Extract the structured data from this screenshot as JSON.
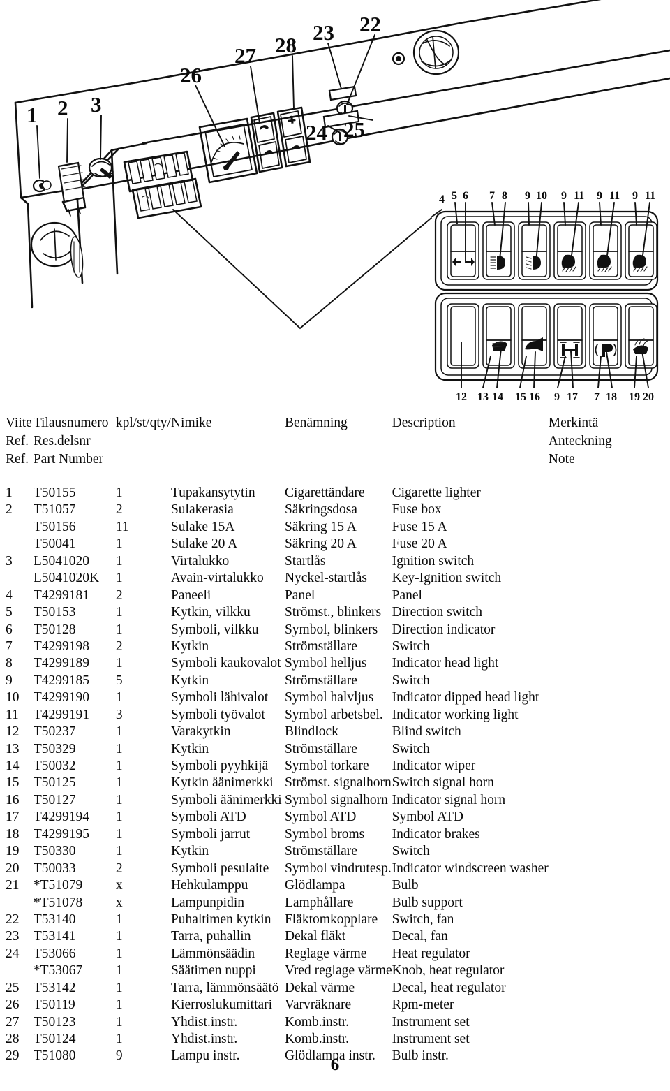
{
  "page": {
    "number": "6"
  },
  "diagram": {
    "title": "dashboard-panel-exploded-view",
    "panel_callouts_top": [
      "1",
      "2",
      "3",
      "26",
      "27",
      "28",
      "23",
      "22"
    ],
    "panel_callouts_bottom": [
      "24",
      "25"
    ],
    "switch_callouts_top": [
      "4",
      "5",
      "6",
      "7",
      "8",
      "9",
      "10",
      "9",
      "11",
      "9",
      "11",
      "9",
      "11"
    ],
    "switch_callouts_bottom": [
      "12",
      "13",
      "14",
      "15",
      "16",
      "9",
      "17",
      "7",
      "18",
      "19",
      "20"
    ],
    "switch_symbols_row1": [
      "turn-signal-arrows-icon",
      "head-light-icon",
      "dipped-head-light-icon",
      "work-light-icon",
      "work-light-icon",
      "work-light-icon"
    ],
    "switch_symbols_row2": [
      "blank-icon",
      "windscreen-wiper-icon",
      "signal-horn-icon",
      "atd-icon",
      "parking-brake-icon",
      "windscreen-washer-icon"
    ]
  },
  "table": {
    "header": {
      "line1": [
        "Viite",
        "Tilausnumero",
        "kpl/st/qty/",
        "Nimike",
        "Benämning",
        "Description",
        "Merkintä"
      ],
      "line2": [
        "Ref.",
        "Res.delsnr",
        "",
        "",
        "",
        "",
        "Anteckning"
      ],
      "line3": [
        "Ref.",
        "Part Number",
        "",
        "",
        "",
        "",
        "Note"
      ]
    },
    "rows": [
      {
        "ref": "1",
        "part": "T50155",
        "qty": "1",
        "nimike": "Tupakansytytin",
        "benamning": "Cigarettändare",
        "description": "Cigarette lighter",
        "note": ""
      },
      {
        "ref": "2",
        "part": "T51057",
        "qty": "2",
        "nimike": "Sulakerasia",
        "benamning": "Säkringsdosa",
        "description": "Fuse box",
        "note": ""
      },
      {
        "ref": "",
        "part": "T50156",
        "qty": "11",
        "nimike": "Sulake 15A",
        "benamning": "Säkring 15 A",
        "description": "Fuse 15 A",
        "note": ""
      },
      {
        "ref": "",
        "part": "T50041",
        "qty": "1",
        "nimike": "Sulake 20 A",
        "benamning": "Säkring 20 A",
        "description": "Fuse 20 A",
        "note": ""
      },
      {
        "ref": "3",
        "part": "L5041020",
        "qty": "1",
        "nimike": "Virtalukko",
        "benamning": "Startlås",
        "description": "Ignition switch",
        "note": ""
      },
      {
        "ref": "",
        "part": "L5041020K",
        "qty": "1",
        "nimike": "Avain-virtalukko",
        "benamning": "Nyckel-startlås",
        "description": "Key-Ignition switch",
        "note": ""
      },
      {
        "ref": "4",
        "part": "T4299181",
        "qty": "2",
        "nimike": "Paneeli",
        "benamning": "Panel",
        "description": "Panel",
        "note": ""
      },
      {
        "ref": "5",
        "part": "T50153",
        "qty": "1",
        "nimike": "Kytkin, vilkku",
        "benamning": "Strömst., blinkers",
        "description": "Direction switch",
        "note": ""
      },
      {
        "ref": "6",
        "part": "T50128",
        "qty": "1",
        "nimike": "Symboli, vilkku",
        "benamning": "Symbol, blinkers",
        "description": "Direction indicator",
        "note": ""
      },
      {
        "ref": "7",
        "part": "T4299198",
        "qty": "2",
        "nimike": "Kytkin",
        "benamning": "Strömställare",
        "description": "Switch",
        "note": ""
      },
      {
        "ref": "8",
        "part": "T4299189",
        "qty": "1",
        "nimike": "Symboli kaukovalot",
        "benamning": "Symbol helljus",
        "description": "Indicator head light",
        "note": ""
      },
      {
        "ref": "9",
        "part": "T4299185",
        "qty": "5",
        "nimike": "Kytkin",
        "benamning": "Strömställare",
        "description": "Switch",
        "note": ""
      },
      {
        "ref": "10",
        "part": "T4299190",
        "qty": "1",
        "nimike": "Symboli lähivalot",
        "benamning": "Symbol halvljus",
        "description": "Indicator dipped head light",
        "note": ""
      },
      {
        "ref": "11",
        "part": "T4299191",
        "qty": "3",
        "nimike": "Symboli työvalot",
        "benamning": "Symbol arbetsbel.",
        "description": "Indicator working light",
        "note": ""
      },
      {
        "ref": "12",
        "part": "T50237",
        "qty": "1",
        "nimike": "Varakytkin",
        "benamning": "Blindlock",
        "description": "Blind switch",
        "note": ""
      },
      {
        "ref": "13",
        "part": "T50329",
        "qty": "1",
        "nimike": "Kytkin",
        "benamning": "Strömställare",
        "description": "Switch",
        "note": ""
      },
      {
        "ref": "14",
        "part": "T50032",
        "qty": "1",
        "nimike": "Symboli pyyhkijä",
        "benamning": "Symbol torkare",
        "description": "Indicator wiper",
        "note": ""
      },
      {
        "ref": "15",
        "part": "T50125",
        "qty": "1",
        "nimike": "Kytkin äänimerkki",
        "benamning": "Strömst. signalhorn",
        "description": "Switch signal horn",
        "note": ""
      },
      {
        "ref": "16",
        "part": "T50127",
        "qty": "1",
        "nimike": "Symboli äänimerkki",
        "benamning": "Symbol signalhorn",
        "description": "Indicator signal horn",
        "note": ""
      },
      {
        "ref": "17",
        "part": "T4299194",
        "qty": "1",
        "nimike": "Symboli ATD",
        "benamning": "Symbol ATD",
        "description": "Symbol ATD",
        "note": ""
      },
      {
        "ref": "18",
        "part": "T4299195",
        "qty": "1",
        "nimike": "Symboli jarrut",
        "benamning": "Symbol broms",
        "description": "Indicator brakes",
        "note": ""
      },
      {
        "ref": "19",
        "part": "T50330",
        "qty": "1",
        "nimike": "Kytkin",
        "benamning": "Strömställare",
        "description": "Switch",
        "note": ""
      },
      {
        "ref": "20",
        "part": "T50033",
        "qty": "2",
        "nimike": "Symboli pesulaite",
        "benamning": "Symbol vindrutesp.",
        "description": "Indicator windscreen washer",
        "note": ""
      },
      {
        "ref": "21",
        "part": "*T51079",
        "qty": "x",
        "nimike": "Hehkulamppu",
        "benamning": "Glödlampa",
        "description": "Bulb",
        "note": ""
      },
      {
        "ref": "",
        "part": "*T51078",
        "qty": "x",
        "nimike": "Lampunpidin",
        "benamning": "Lamphållare",
        "description": "Bulb support",
        "note": ""
      },
      {
        "ref": "22",
        "part": "T53140",
        "qty": "1",
        "nimike": "Puhaltimen kytkin",
        "benamning": "Fläktomkopplare",
        "description": "Switch, fan",
        "note": ""
      },
      {
        "ref": "23",
        "part": "T53141",
        "qty": "1",
        "nimike": "Tarra, puhallin",
        "benamning": "Dekal fläkt",
        "description": "Decal, fan",
        "note": ""
      },
      {
        "ref": "24",
        "part": "T53066",
        "qty": "1",
        "nimike": "Lämmönsäädin",
        "benamning": "Reglage värme",
        "description": "Heat regulator",
        "note": ""
      },
      {
        "ref": "",
        "part": "*T53067",
        "qty": "1",
        "nimike": "Säätimen nuppi",
        "benamning": "Vred reglage värme",
        "description": "Knob, heat regulator",
        "note": ""
      },
      {
        "ref": "25",
        "part": "T53142",
        "qty": "1",
        "nimike": "Tarra, lämmönsäätö",
        "benamning": "Dekal värme",
        "description": "Decal, heat regulator",
        "note": ""
      },
      {
        "ref": "26",
        "part": "T50119",
        "qty": "1",
        "nimike": "Kierroslukumittari",
        "benamning": "Varvräknare",
        "description": "Rpm-meter",
        "note": ""
      },
      {
        "ref": "27",
        "part": "T50123",
        "qty": "1",
        "nimike": "Yhdist.instr.",
        "benamning": "Komb.instr.",
        "description": "Instrument set",
        "note": ""
      },
      {
        "ref": "28",
        "part": "T50124",
        "qty": "1",
        "nimike": "Yhdist.instr.",
        "benamning": "Komb.instr.",
        "description": "Instrument set",
        "note": ""
      },
      {
        "ref": "29",
        "part": "T51080",
        "qty": "9",
        "nimike": "Lampu instr.",
        "benamning": "Glödlampa instr.",
        "description": "Bulb instr.",
        "note": ""
      }
    ]
  }
}
